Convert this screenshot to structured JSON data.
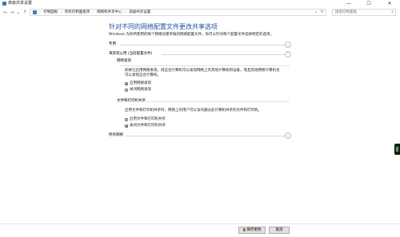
{
  "window": {
    "title": "高级共享设置",
    "controls": {
      "minimize": "—",
      "maximize": "☐",
      "close": "✕"
    }
  },
  "nav": {
    "back": "←",
    "forward": "→",
    "up": "↑",
    "recent": "⌄"
  },
  "breadcrumb": {
    "items": [
      "控制面板",
      "所有控制面板项",
      "网络和共享中心",
      "高级共享设置"
    ],
    "separator": "›"
  },
  "search": {
    "placeholder": "搜索控制面板"
  },
  "main": {
    "heading": "针对不同的网络配置文件更改共享选项",
    "intro": "Windows 为你所使用的每个网络创建单独的网络配置文件。你可以针对每个配置文件选择特定的选项。",
    "sections": [
      {
        "label": "专用",
        "expanded": false
      },
      {
        "label": "来宾或公用 (当前配置文件)",
        "expanded": true
      },
      {
        "label": "所有网络",
        "expanded": false
      }
    ],
    "network_discovery": {
      "title": "网络发现",
      "desc_line1": "如果已启用网络发现，则这台计算机可以发现网络上的其他计算机和设备，而且其他网络计算机也",
      "desc_line2": "可以发现这台计算机。",
      "options": [
        {
          "label": "启用网络发现",
          "selected": true
        },
        {
          "label": "关闭网络发现",
          "selected": false
        }
      ]
    },
    "file_printer_sharing": {
      "title": "文件和打印机共享",
      "desc": "启用文件和打印机共享时，网络上的用户可以访问通过此计算机共享的文件和打印机。",
      "options": [
        {
          "label": "启用文件和打印机共享",
          "selected": false
        },
        {
          "label": "关闭文件和打印机共享",
          "selected": true
        }
      ]
    }
  },
  "footer": {
    "save_label": "保存更改",
    "cancel_label": "取消"
  },
  "colors": {
    "heading": "#1f4e9c",
    "accent": "#2b7bbd"
  }
}
